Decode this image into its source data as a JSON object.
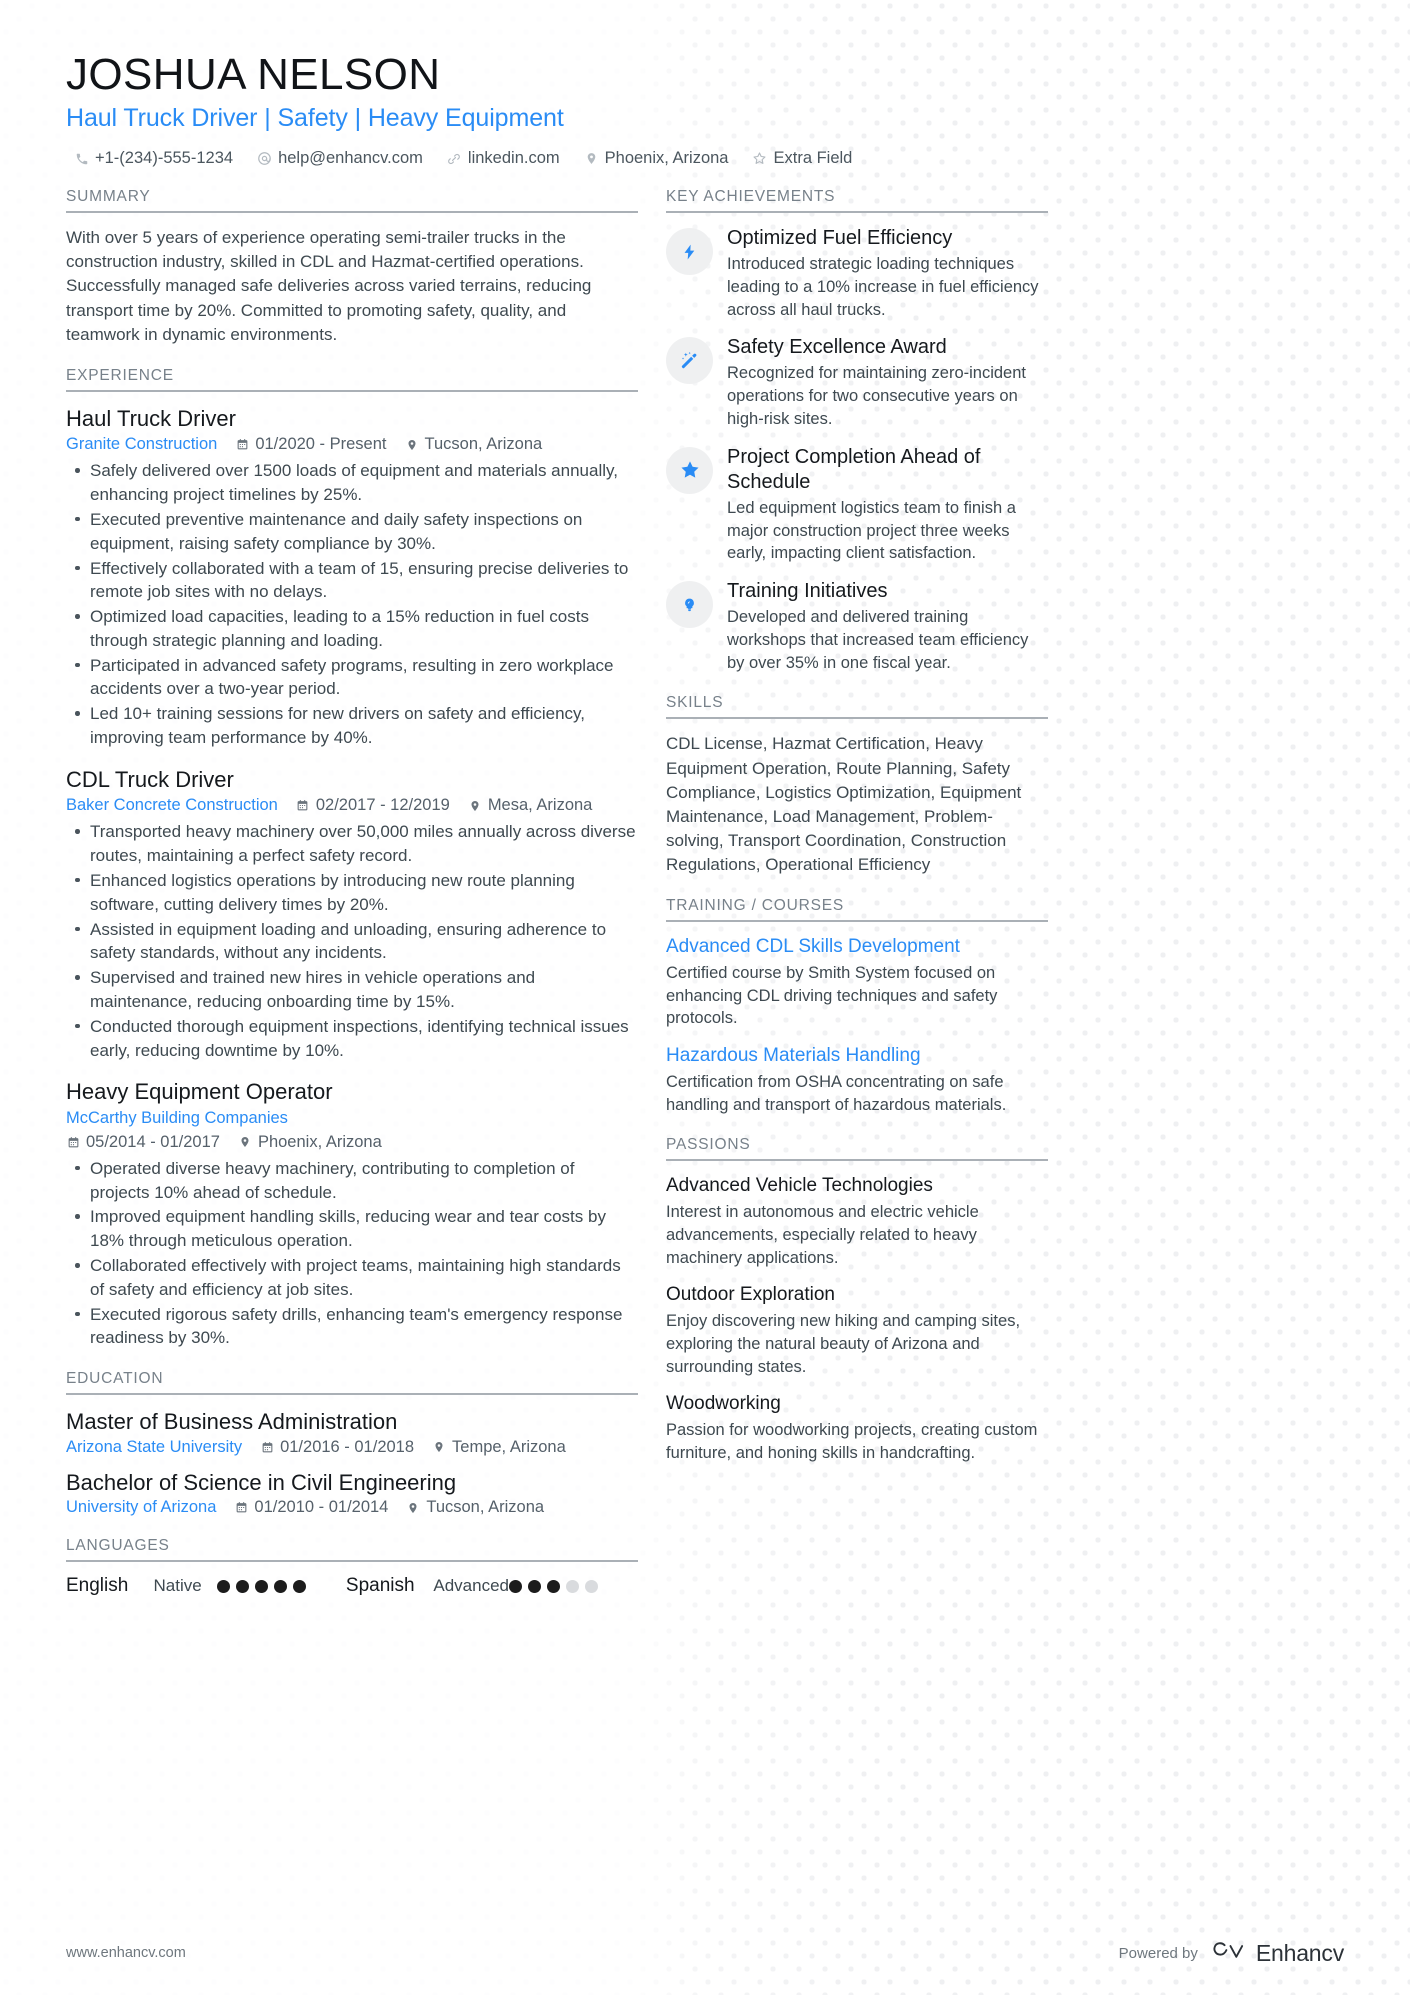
{
  "header": {
    "name": "JOSHUA NELSON",
    "headline": "Haul Truck Driver | Safety | Heavy Equipment",
    "contacts": [
      {
        "icon": "phone-icon",
        "text": "+1-(234)-555-1234"
      },
      {
        "icon": "email-icon",
        "text": "help@enhancv.com"
      },
      {
        "icon": "link-icon",
        "text": "linkedin.com"
      },
      {
        "icon": "location-pin-icon",
        "text": "Phoenix, Arizona"
      },
      {
        "icon": "star-outline-icon",
        "text": "Extra Field"
      }
    ]
  },
  "left": {
    "summary": {
      "title": "SUMMARY",
      "text": "With over 5 years of experience operating semi-trailer trucks in the construction industry, skilled in CDL and Hazmat-certified operations. Successfully managed safe deliveries across varied terrains, reducing transport time by 20%. Committed to promoting safety, quality, and teamwork in dynamic environments."
    },
    "experience": {
      "title": "EXPERIENCE",
      "entries": [
        {
          "role": "Haul Truck Driver",
          "org": "Granite Construction",
          "dates": "01/2020 - Present",
          "location": "Tucson, Arizona",
          "bullets": [
            "Safely delivered over 1500 loads of equipment and materials annually, enhancing project timelines by 25%.",
            "Executed preventive maintenance and daily safety inspections on equipment, raising safety compliance by 30%.",
            "Effectively collaborated with a team of 15, ensuring precise deliveries to remote job sites with no delays.",
            "Optimized load capacities, leading to a 15% reduction in fuel costs through strategic planning and loading.",
            "Participated in advanced safety programs, resulting in zero workplace accidents over a two-year period.",
            "Led 10+ training sessions for new drivers on safety and efficiency, improving team performance by 40%."
          ]
        },
        {
          "role": "CDL Truck Driver",
          "org": "Baker Concrete Construction",
          "dates": "02/2017 - 12/2019",
          "location": "Mesa, Arizona",
          "bullets": [
            "Transported heavy machinery over 50,000 miles annually across diverse routes, maintaining a perfect safety record.",
            "Enhanced logistics operations by introducing new route planning software, cutting delivery times by 20%.",
            "Assisted in equipment loading and unloading, ensuring adherence to safety standards, without any incidents.",
            "Supervised and trained new hires in vehicle operations and maintenance, reducing onboarding time by 15%.",
            "Conducted thorough equipment inspections, identifying technical issues early, reducing downtime by 10%."
          ]
        },
        {
          "role": "Heavy Equipment Operator",
          "org": "McCarthy Building Companies",
          "dates": "05/2014 - 01/2017",
          "location": "Phoenix, Arizona",
          "bullets": [
            "Operated diverse heavy machinery, contributing to completion of projects 10% ahead of schedule.",
            "Improved equipment handling skills, reducing wear and tear costs by 18% through meticulous operation.",
            "Collaborated effectively with project teams, maintaining high standards of safety and efficiency at job sites.",
            "Executed rigorous safety drills, enhancing team's emergency response readiness by 30%."
          ]
        }
      ]
    },
    "education": {
      "title": "EDUCATION",
      "entries": [
        {
          "degree": "Master of Business Administration",
          "school": "Arizona State University",
          "dates": "01/2016 - 01/2018",
          "location": "Tempe, Arizona"
        },
        {
          "degree": "Bachelor of Science in Civil Engineering",
          "school": "University of Arizona",
          "dates": "01/2010 - 01/2014",
          "location": "Tucson, Arizona"
        }
      ]
    },
    "languages": {
      "title": "LANGUAGES",
      "items": [
        {
          "name": "English",
          "level": "Native",
          "filled": 5,
          "total": 5
        },
        {
          "name": "Spanish",
          "level": "Advanced",
          "filled": 3,
          "total": 5
        }
      ]
    }
  },
  "right": {
    "key_achievements": {
      "title": "KEY ACHIEVEMENTS",
      "items": [
        {
          "icon": "lightning-bolt-icon",
          "title": "Optimized Fuel Efficiency",
          "desc": "Introduced strategic loading techniques leading to a 10% increase in fuel efficiency across all haul trucks."
        },
        {
          "icon": "magic-wand-icon",
          "title": "Safety Excellence Award",
          "desc": "Recognized for maintaining zero-incident operations for two consecutive years on high-risk sites."
        },
        {
          "icon": "star-icon",
          "title": "Project Completion Ahead of Schedule",
          "desc": "Led equipment logistics team to finish a major construction project three weeks early, impacting client satisfaction."
        },
        {
          "icon": "lightbulb-icon",
          "title": "Training Initiatives",
          "desc": "Developed and delivered training workshops that increased team efficiency by over 35% in one fiscal year."
        }
      ]
    },
    "skills": {
      "title": "SKILLS",
      "text": "CDL License, Hazmat Certification, Heavy Equipment Operation, Route Planning, Safety Compliance, Logistics Optimization, Equipment Maintenance, Load Management, Problem-solving, Transport Coordination, Construction Regulations, Operational Efficiency"
    },
    "training": {
      "title": "TRAINING / COURSES",
      "items": [
        {
          "title": "Advanced CDL Skills Development",
          "desc": "Certified course by Smith System focused on enhancing CDL driving techniques and safety protocols."
        },
        {
          "title": "Hazardous Materials Handling",
          "desc": "Certification from OSHA concentrating on safe handling and transport of hazardous materials."
        }
      ]
    },
    "passions": {
      "title": "PASSIONS",
      "items": [
        {
          "title": "Advanced Vehicle Technologies",
          "desc": "Interest in autonomous and electric vehicle advancements, especially related to heavy machinery applications."
        },
        {
          "title": "Outdoor Exploration",
          "desc": "Enjoy discovering new hiking and camping sites, exploring the natural beauty of Arizona and surrounding states."
        },
        {
          "title": "Woodworking",
          "desc": "Passion for woodworking projects, creating custom furniture, and honing skills in handcrafting."
        }
      ]
    }
  },
  "footer": {
    "url": "www.enhancv.com",
    "powered_by": "Powered by",
    "brand": "Enhancv"
  },
  "colors": {
    "accent": "#2a8cf5",
    "heading": "#77818a",
    "text": "#3e4950",
    "rule": "#aab0b6"
  }
}
